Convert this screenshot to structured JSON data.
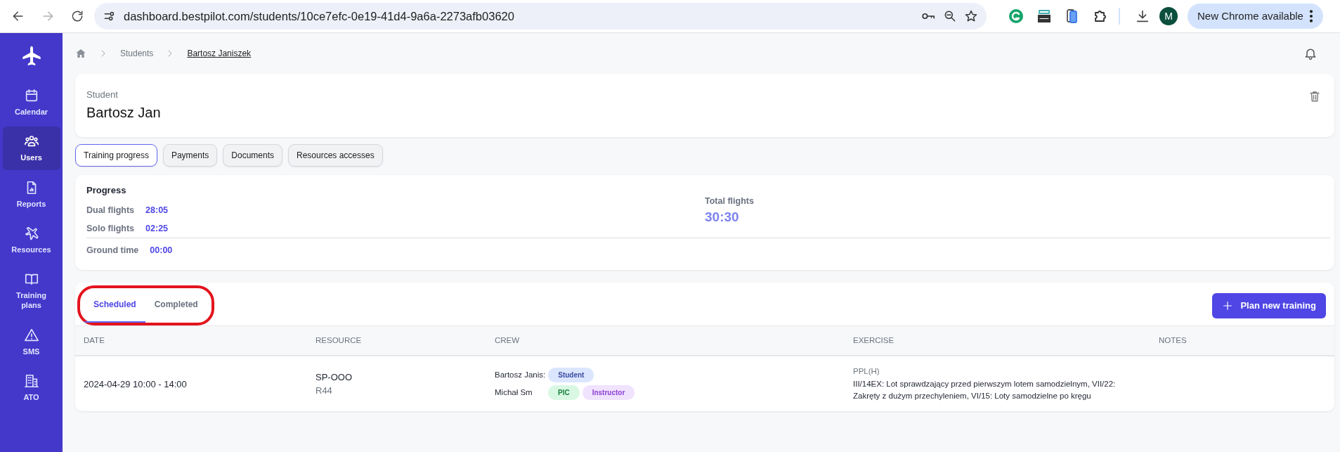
{
  "browser": {
    "url": "dashboard.bestpilot.com/students/10ce7efc-0e19-41d4-9a6a-2273afb03620",
    "back_disabled": false,
    "forward_disabled": true,
    "profile_initial": "M",
    "update_label": "New Chrome available"
  },
  "sidebar": {
    "items": [
      {
        "label": "Calendar",
        "selected": false
      },
      {
        "label": "Users",
        "selected": true
      },
      {
        "label": "Reports",
        "selected": false
      },
      {
        "label": "Resources",
        "selected": false
      },
      {
        "label": "Training plans",
        "selected": false
      },
      {
        "label": "SMS",
        "selected": false
      },
      {
        "label": "ATO",
        "selected": false
      }
    ]
  },
  "breadcrumb": [
    "Students",
    "Bartosz Janiszek"
  ],
  "student": {
    "caption": "Student",
    "name": "Bartosz Jan"
  },
  "tabs": [
    {
      "label": "Training progress",
      "selected": true
    },
    {
      "label": "Payments",
      "selected": false
    },
    {
      "label": "Documents",
      "selected": false
    },
    {
      "label": "Resources accesses",
      "selected": false
    }
  ],
  "progress": {
    "title": "Progress",
    "rows": [
      {
        "label": "Dual flights",
        "value": "28:05"
      },
      {
        "label": "Solo flights",
        "value": "02:25"
      },
      {
        "label": "Ground time",
        "value": "00:00"
      }
    ],
    "total_label": "Total flights",
    "total_value": "30:30"
  },
  "trainings": {
    "tabs": [
      {
        "label": "Scheduled",
        "selected": true
      },
      {
        "label": "Completed",
        "selected": false
      }
    ],
    "tabs_circled": true,
    "button": "Plan new training",
    "table": {
      "columns": [
        "DATE",
        "RESOURCE",
        "CREW",
        "EXERCISE",
        "NOTES"
      ],
      "rows": [
        {
          "date": "2024-04-29 10:00 - 14:00",
          "resource": "SP-OOO",
          "resource_type": "R44",
          "crew": [
            {
              "name": "Bartosz Janis:",
              "roles": [
                {
                  "label": "Student",
                  "kind": "student"
                }
              ]
            },
            {
              "name": "Michał Sm",
              "roles": [
                {
                  "label": "PIC",
                  "kind": "pic"
                },
                {
                  "label": "Instructor",
                  "kind": "instructor"
                }
              ]
            }
          ],
          "exercise_program": "PPL(H)",
          "exercise": "III/14EX: Lot sprawdzający przed pierwszym lotem samodzielnym, VII/22: Zakręty z dużym przechyleniem, VI/15: Loty samodzielne po kręgu"
        }
      ]
    }
  }
}
